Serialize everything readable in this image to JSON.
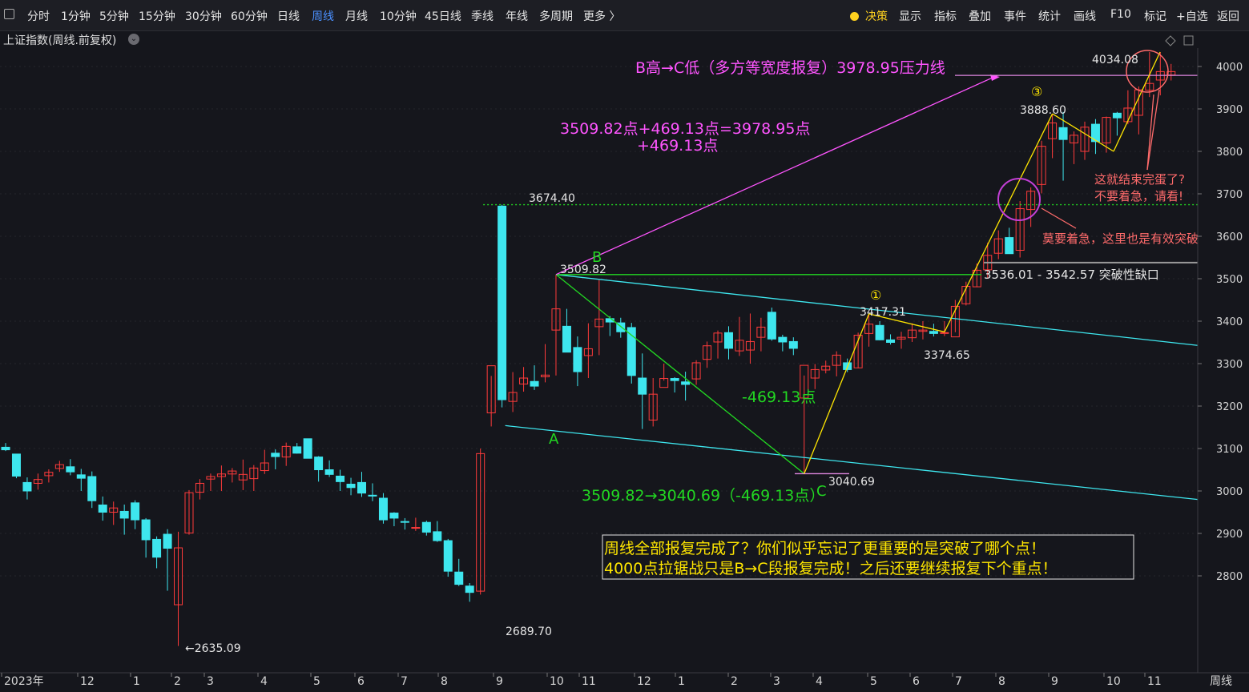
{
  "toolbar": {
    "left_tabs": [
      "分时",
      "1分钟",
      "5分钟",
      "15分钟",
      "30分钟",
      "60分钟",
      "日线",
      "周线",
      "月线",
      "10分钟",
      "45日线",
      "季线",
      "年线",
      "多周期",
      "更多 〉"
    ],
    "active_tab": "周线",
    "right_items": [
      "决策",
      "显示",
      "指标",
      "叠加",
      "事件",
      "统计",
      "画线",
      "F10",
      "标记",
      "+自选",
      "返回"
    ]
  },
  "chart_title": "上证指数(周线.前复权)",
  "period_label": "周线",
  "colors": {
    "up": "#ff3b3b",
    "down": "#3ee6ee",
    "bg": "#15161c",
    "grid": "#2a2b33",
    "annot_pink": "#ff55ff",
    "annot_green": "#22d822",
    "annot_yellow": "#ffe600",
    "annot_salmon": "#ff6b6b",
    "annot_cyan": "#3ee6ee"
  },
  "chart_data": {
    "type": "candlestick",
    "y_ticks": [
      2800,
      2900,
      3000,
      3100,
      3200,
      3300,
      3400,
      3500,
      3600,
      3700,
      3800,
      3900,
      4000
    ],
    "x_labels": [
      "2023年",
      "12",
      "1",
      "2",
      "3",
      "4",
      "5",
      "6",
      "7",
      "8",
      "9",
      "10",
      "11",
      "12",
      "1",
      "2",
      "3",
      "4",
      "5",
      "6",
      "7",
      "8",
      "9",
      "10",
      "11"
    ],
    "candles": [
      [
        3103,
        3113,
        3094,
        3097
      ],
      [
        3087,
        3087,
        3030,
        3035
      ],
      [
        3020,
        3032,
        2980,
        3000
      ],
      [
        3018,
        3041,
        3003,
        3027
      ],
      [
        3036,
        3051,
        3020,
        3044
      ],
      [
        3053,
        3071,
        3045,
        3062
      ],
      [
        3057,
        3075,
        3037,
        3045
      ],
      [
        3038,
        3052,
        3000,
        3030
      ],
      [
        3034,
        3046,
        2960,
        2977
      ],
      [
        2967,
        2987,
        2930,
        2950
      ],
      [
        2950,
        2975,
        2920,
        2960
      ],
      [
        2952,
        2968,
        2897,
        2936
      ],
      [
        2972,
        2978,
        2910,
        2932
      ],
      [
        2932,
        2936,
        2843,
        2885
      ],
      [
        2886,
        2893,
        2818,
        2844
      ],
      [
        2898,
        2910,
        2765,
        2865
      ],
      [
        2732,
        2904,
        2635,
        2866
      ],
      [
        2901,
        3002,
        2897,
        2996
      ],
      [
        2997,
        3028,
        2980,
        3018
      ],
      [
        3028,
        3041,
        3000,
        3034
      ],
      [
        3034,
        3060,
        3000,
        3040
      ],
      [
        3040,
        3054,
        3020,
        3047
      ],
      [
        3026,
        3074,
        3002,
        3039
      ],
      [
        3029,
        3061,
        3000,
        3054
      ],
      [
        3048,
        3097,
        3040,
        3066
      ],
      [
        3089,
        3098,
        3051,
        3081
      ],
      [
        3080,
        3114,
        3059,
        3105
      ],
      [
        3104,
        3113,
        3088,
        3089
      ],
      [
        3123,
        3123,
        3078,
        3077
      ],
      [
        3080,
        3082,
        3022,
        3050
      ],
      [
        3050,
        3072,
        3033,
        3039
      ],
      [
        3035,
        3050,
        3000,
        3022
      ],
      [
        3016,
        3031,
        2990,
        3008
      ],
      [
        3020,
        3045,
        2986,
        2995
      ],
      [
        2990,
        3018,
        2976,
        2988
      ],
      [
        2983,
        2995,
        2923,
        2932
      ],
      [
        2948,
        2950,
        2917,
        2936
      ],
      [
        2928,
        2936,
        2909,
        2927
      ],
      [
        2913,
        2937,
        2906,
        2914
      ],
      [
        2926,
        2930,
        2895,
        2903
      ],
      [
        2904,
        2929,
        2880,
        2883
      ],
      [
        2883,
        2887,
        2798,
        2811
      ],
      [
        2809,
        2840,
        2776,
        2780
      ],
      [
        2776,
        2783,
        2739,
        2761
      ],
      [
        2764,
        3100,
        2756,
        3088
      ],
      [
        3184,
        3271,
        3152,
        3295
      ],
      [
        3671,
        3674,
        3197,
        3215
      ],
      [
        3211,
        3280,
        3186,
        3232
      ],
      [
        3252,
        3292,
        3234,
        3266
      ],
      [
        3258,
        3296,
        3238,
        3247
      ],
      [
        3269,
        3346,
        3256,
        3273
      ],
      [
        3379,
        3509,
        3272,
        3429
      ],
      [
        3388,
        3429,
        3329,
        3327
      ],
      [
        3338,
        3364,
        3247,
        3281
      ],
      [
        3319,
        3395,
        3266,
        3335
      ],
      [
        3387,
        3497,
        3320,
        3405
      ],
      [
        3406,
        3412,
        3365,
        3398
      ],
      [
        3396,
        3408,
        3361,
        3375
      ],
      [
        3385,
        3396,
        3253,
        3272
      ],
      [
        3266,
        3324,
        3146,
        3228
      ],
      [
        3167,
        3266,
        3152,
        3228
      ],
      [
        3244,
        3300,
        3260,
        3265
      ],
      [
        3265,
        3268,
        3232,
        3260
      ],
      [
        3257,
        3281,
        3213,
        3251
      ],
      [
        3264,
        3308,
        3250,
        3302
      ],
      [
        3310,
        3352,
        3290,
        3342
      ],
      [
        3351,
        3378,
        3312,
        3372
      ],
      [
        3373,
        3388,
        3310,
        3336
      ],
      [
        3330,
        3410,
        3318,
        3355
      ],
      [
        3332,
        3418,
        3300,
        3352
      ],
      [
        3362,
        3408,
        3329,
        3386
      ],
      [
        3421,
        3432,
        3354,
        3358
      ],
      [
        3362,
        3368,
        3329,
        3351
      ],
      [
        3352,
        3362,
        3320,
        3336
      ],
      [
        3219,
        3272,
        3040,
        3296
      ],
      [
        3266,
        3299,
        3240,
        3286
      ],
      [
        3285,
        3307,
        3277,
        3294
      ],
      [
        3296,
        3329,
        3270,
        3320
      ],
      [
        3302,
        3312,
        3280,
        3286
      ],
      [
        3290,
        3373,
        3289,
        3367
      ],
      [
        3371,
        3417,
        3340,
        3393
      ],
      [
        3390,
        3400,
        3355,
        3356
      ],
      [
        3356,
        3369,
        3345,
        3350
      ],
      [
        3358,
        3375,
        3335,
        3362
      ],
      [
        3361,
        3395,
        3351,
        3379
      ],
      [
        3376,
        3400,
        3357,
        3379
      ],
      [
        3376,
        3394,
        3364,
        3371
      ],
      [
        3372,
        3400,
        3365,
        3373
      ],
      [
        3363,
        3450,
        3374,
        3435
      ],
      [
        3441,
        3493,
        3437,
        3482
      ],
      [
        3481,
        3536,
        3480,
        3520
      ],
      [
        3521,
        3585,
        3502,
        3555
      ],
      [
        3560,
        3614,
        3546,
        3594
      ],
      [
        3597,
        3620,
        3573,
        3559
      ],
      [
        3567,
        3683,
        3550,
        3665
      ],
      [
        3663,
        3715,
        3622,
        3706
      ],
      [
        3722,
        3825,
        3701,
        3812
      ],
      [
        3830,
        3888,
        3784,
        3867
      ],
      [
        3856,
        3893,
        3731,
        3828
      ],
      [
        3820,
        3847,
        3770,
        3838
      ],
      [
        3800,
        3870,
        3780,
        3857
      ],
      [
        3864,
        3876,
        3794,
        3823
      ],
      [
        3820,
        3882,
        3797,
        3880
      ],
      [
        3890,
        3893,
        3837,
        3879
      ],
      [
        3870,
        3944,
        3864,
        3902
      ],
      [
        3885,
        3953,
        3840,
        3945
      ],
      [
        3944,
        4034,
        3928,
        3960
      ],
      [
        3968,
        4034,
        3932,
        3988
      ],
      [
        3980,
        4006,
        3967,
        3988
      ]
    ]
  },
  "annotations": {
    "resistance_line": "B高→C低（多方等宽度报复）3978.95压力线",
    "calc_line1": "3509.82点+469.13点=3978.95点",
    "calc_line2": "+469.13点",
    "high_label": "3674.40",
    "b_label": "B",
    "b_value": "3509.82",
    "a_label": "A",
    "c_label": "C",
    "c_value": "3040.69",
    "drop_label": "-469.13点",
    "bc_text": "3509.82→3040.69（-469.13点）",
    "low_label": "←2635.09",
    "low2_label": "2689.70",
    "p1_label": "①",
    "p1_value": "3417.31",
    "p2_value": "3374.65",
    "p3_label": "③",
    "p3_value": "3888.60",
    "top_value": "4034.08",
    "gap_label": "3536.01 - 3542.57   突破性缺口",
    "note_top1": "这就结束完蛋了?",
    "note_top2": "不要着急，请看!",
    "note_mid": "莫要着急，这里也是有效突破",
    "box_line1": "周线全部报复完成了？你们似乎忘记了更重要的是突破了哪个点！",
    "box_line2": "4000点拉锯战只是B→C段报复完成！之后还要继续报复下个重点！"
  }
}
